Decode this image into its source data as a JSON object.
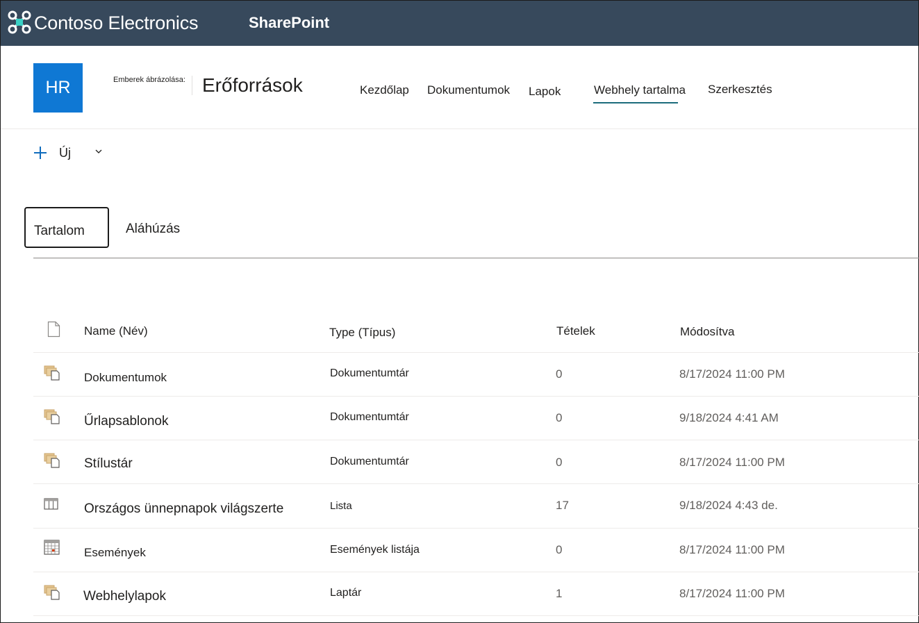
{
  "suite": {
    "brand": "Contoso Electronics",
    "app": "SharePoint"
  },
  "site": {
    "logo_text": "HR",
    "prefix": "Emberek ábrázolása:",
    "title": "Erőforrások",
    "nav": [
      "Kezdőlap",
      "Dokumentumok",
      "Lapok",
      "Webhely tartalma",
      "Szerkesztés"
    ],
    "active_nav": "Webhely tartalma"
  },
  "command": {
    "new_label": "Új"
  },
  "tabs": [
    "Tartalom",
    "Aláhúzás"
  ],
  "list": {
    "columns": [
      "Name (Név)",
      "Type (Típus)",
      "Tételek",
      "Módosítva"
    ],
    "rows": [
      {
        "icon": "document-library-icon",
        "name": "Dokumentumok",
        "type": "Dokumentumtár",
        "items": "0",
        "modified": "8/17/2024 11:00 PM"
      },
      {
        "icon": "document-library-icon",
        "name": "Űrlapsablonok",
        "type": "Dokumentumtár",
        "items": "0",
        "modified": "9/18/2024 4:41 AM"
      },
      {
        "icon": "document-library-icon",
        "name": "Stílustár",
        "type": "Dokumentumtár",
        "items": "0",
        "modified": "8/17/2024 11:00 PM"
      },
      {
        "icon": "list-icon",
        "name": "Országos ünnepnapok világszerte",
        "type": "Lista",
        "items": "17",
        "modified": "9/18/2024 4:43 de."
      },
      {
        "icon": "calendar-icon",
        "name": "Események",
        "type": "Események listája",
        "items": "0",
        "modified": "8/17/2024 11:00 PM"
      },
      {
        "icon": "document-library-icon",
        "name": "Webhelylapok",
        "type": "Laptár",
        "items": "1",
        "modified": "8/17/2024 11:00 PM"
      }
    ]
  },
  "colors": {
    "suitebar": "#37495c",
    "site_logo": "#0f78d4",
    "nav_underline": "#1b6b7b",
    "library_icon": "#c8a56c"
  }
}
